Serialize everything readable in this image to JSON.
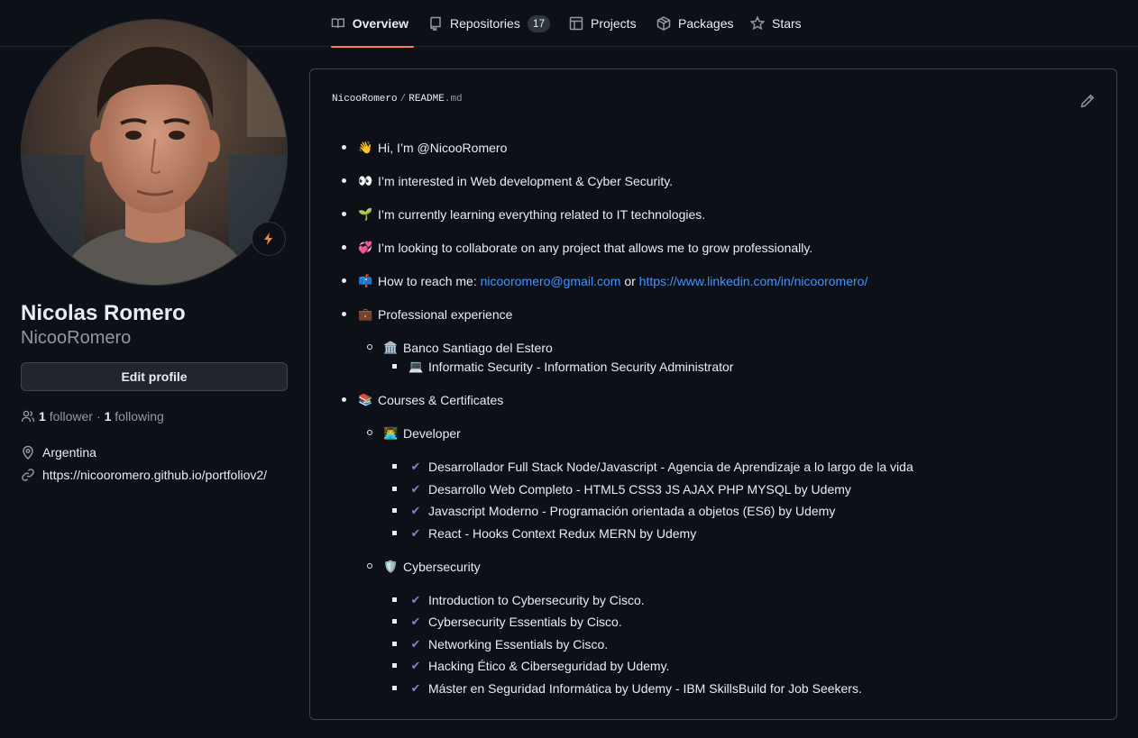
{
  "nav": {
    "tabs": [
      {
        "label": "Overview",
        "icon": "book-icon",
        "active": true
      },
      {
        "label": "Repositories",
        "icon": "repo-icon",
        "count": "17"
      },
      {
        "label": "Projects",
        "icon": "table-icon"
      },
      {
        "label": "Packages",
        "icon": "package-icon"
      },
      {
        "label": "Stars",
        "icon": "star-icon"
      }
    ]
  },
  "profile": {
    "name": "Nicolas Romero",
    "username": "NicooRomero",
    "edit_label": "Edit profile",
    "followers_count": "1",
    "followers_label": "follower",
    "separator": "·",
    "following_count": "1",
    "following_label": "following",
    "location": "Argentina",
    "website": "https://nicooromero.github.io/portfoliov2/"
  },
  "readme": {
    "path_user": "NicooRomero",
    "path_sep": "/",
    "path_file": "README",
    "path_ext": ".md",
    "items": {
      "hi": {
        "emoji": "👋",
        "text": "Hi, I’m @NicooRomero"
      },
      "interested": {
        "emoji": "👀",
        "text": "I’m interested in Web development & Cyber Security."
      },
      "learning": {
        "emoji": "🌱",
        "text": "I’m currently learning everything related to IT technologies."
      },
      "collaborate": {
        "emoji": "💞️",
        "text": "I’m looking to collaborate on any project that allows me to grow professionally."
      },
      "reach": {
        "emoji": "📫",
        "text": "How to reach me:",
        "email": "nicooromero@gmail.com",
        "or": "or",
        "linkedin": "https://www.linkedin.com/in/nicooromero/"
      },
      "experience": {
        "emoji": "💼",
        "text": "Professional experience"
      },
      "bank": {
        "emoji": "🏛️",
        "text": "Banco Santiago del Estero"
      },
      "security_role": {
        "emoji": "💻",
        "text": "Informatic Security - Information Security Administrator"
      },
      "courses": {
        "emoji": "📚",
        "text": "Courses & Certificates"
      },
      "developer": {
        "emoji": "👨‍💻",
        "text": "Developer"
      },
      "cybersecurity": {
        "emoji": "🛡️",
        "text": "Cybersecurity"
      }
    },
    "developer_courses": [
      "Desarrollador Full Stack Node/Javascript - Agencia de Aprendizaje a lo largo de la vida",
      "Desarrollo Web Completo - HTML5 CSS3 JS AJAX PHP MYSQL by Udemy",
      "Javascript Moderno - Programación orientada a objetos (ES6) by Udemy",
      "React - Hooks Context Redux MERN by Udemy"
    ],
    "cyber_courses": [
      "Introduction to Cybersecurity by Cisco.",
      "Cybersecurity Essentials by Cisco.",
      "Networking Essentials by Cisco.",
      "Hacking Ético & Ciberseguridad by Udemy.",
      "Máster en Seguridad Informática by Udemy - IBM SkillsBuild for Job Seekers."
    ],
    "check_mark": "✔"
  },
  "colors": {
    "accent_underline": "#f78166",
    "link": "#4493f8",
    "check": "#8e7cc3",
    "background": "#0d1117"
  }
}
